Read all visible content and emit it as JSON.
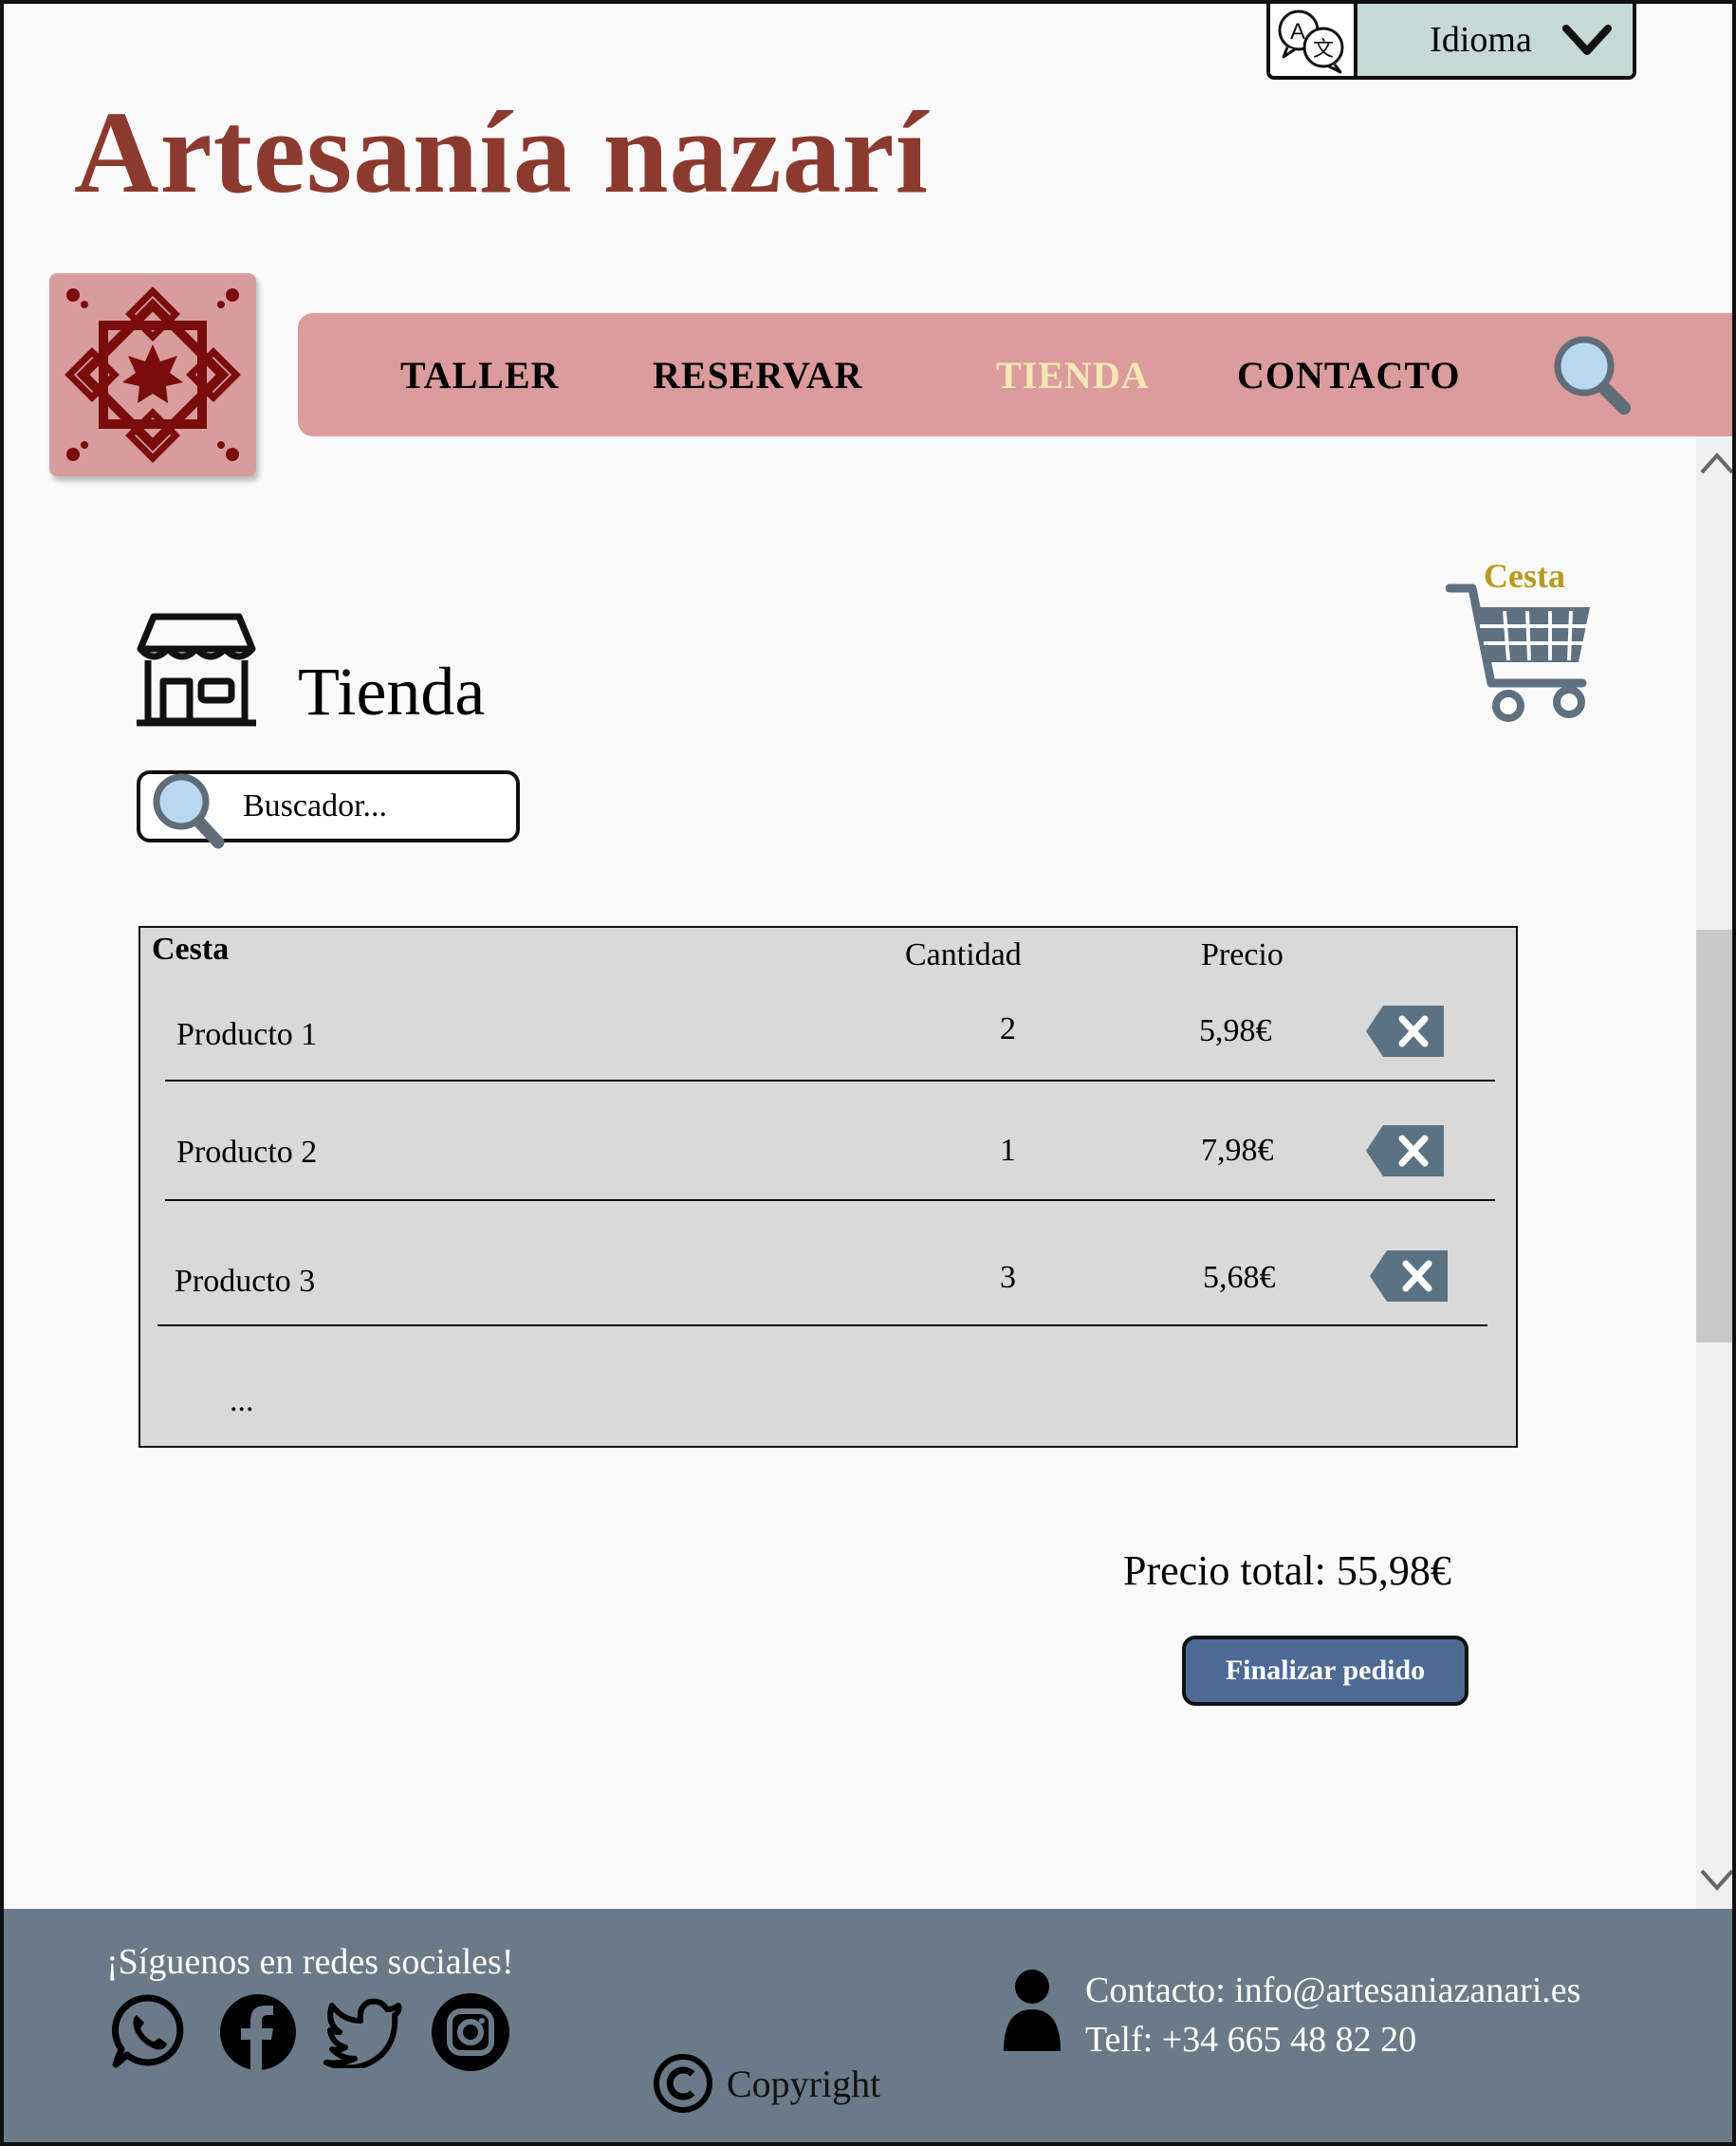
{
  "header": {
    "language_label": "Idioma",
    "site_title": "Artesanía nazarí"
  },
  "nav": {
    "items": [
      {
        "label": "TALLER"
      },
      {
        "label": "RESERVAR"
      },
      {
        "label": "TIENDA",
        "active": true
      },
      {
        "label": "CONTACTO"
      }
    ]
  },
  "cart": {
    "label": "Cesta"
  },
  "page": {
    "title": "Tienda",
    "search_placeholder": "Buscador..."
  },
  "basket": {
    "columns": [
      "Cesta",
      "Cantidad",
      "Precio"
    ],
    "rows": [
      {
        "name": "Producto 1",
        "qty": "2",
        "price": "5,98€"
      },
      {
        "name": "Producto 2",
        "qty": "1",
        "price": "7,98€"
      },
      {
        "name": "Producto 3",
        "qty": "3",
        "price": "5,68€"
      }
    ],
    "more": "..."
  },
  "summary": {
    "total": "Precio total: 55,98€",
    "finish_label": "Finalizar pedido"
  },
  "footer": {
    "follow": "¡Síguenos en redes sociales!",
    "social_icons": [
      "whatsapp-icon",
      "facebook-icon",
      "twitter-icon",
      "instagram-icon"
    ],
    "copyright": "Copyright",
    "contact_email": "Contacto: info@artesaniazanari.es",
    "contact_phone": "Telf: +34 665 48 82 20"
  },
  "colors": {
    "title": "#8c3a2e",
    "nav_bg": "#dc9c9c",
    "nav_active": "#f6e7b5",
    "cart_label": "#b89a1f",
    "basket_bg": "#d9d9d9",
    "finish_button": "#4d6a94",
    "footer_bg": "#6b7a89",
    "lang_bg": "#c5d9d5"
  }
}
